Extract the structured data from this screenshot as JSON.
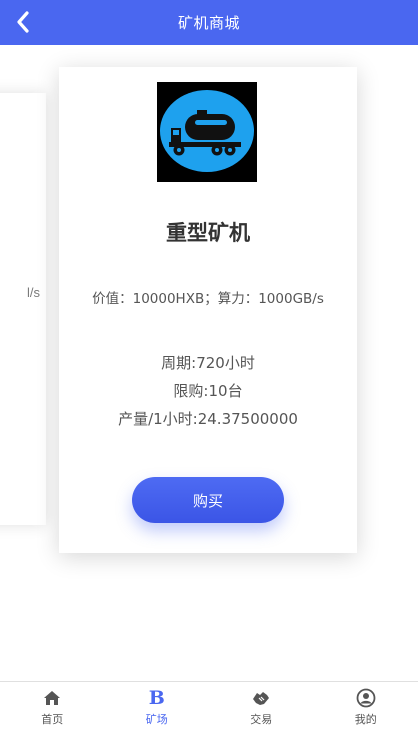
{
  "header": {
    "title": "矿机商城"
  },
  "side_card": {
    "text": "l/s"
  },
  "card": {
    "name": "重型矿机",
    "value_line": "价值：10000HXB；算力：1000GB/s",
    "period": "周期:720小时",
    "limit": "限购:10台",
    "output": "产量/1小时:24.37500000",
    "buy_label": "购买",
    "icon": "tanker-truck-icon"
  },
  "tabbar": {
    "items": [
      {
        "label": "首页",
        "icon": "home-icon"
      },
      {
        "label": "矿场",
        "icon": "b-icon"
      },
      {
        "label": "交易",
        "icon": "handshake-icon"
      },
      {
        "label": "我的",
        "icon": "user-icon"
      }
    ],
    "active_color": "#4a67f0"
  },
  "colors": {
    "accent": "#4a67f0"
  }
}
